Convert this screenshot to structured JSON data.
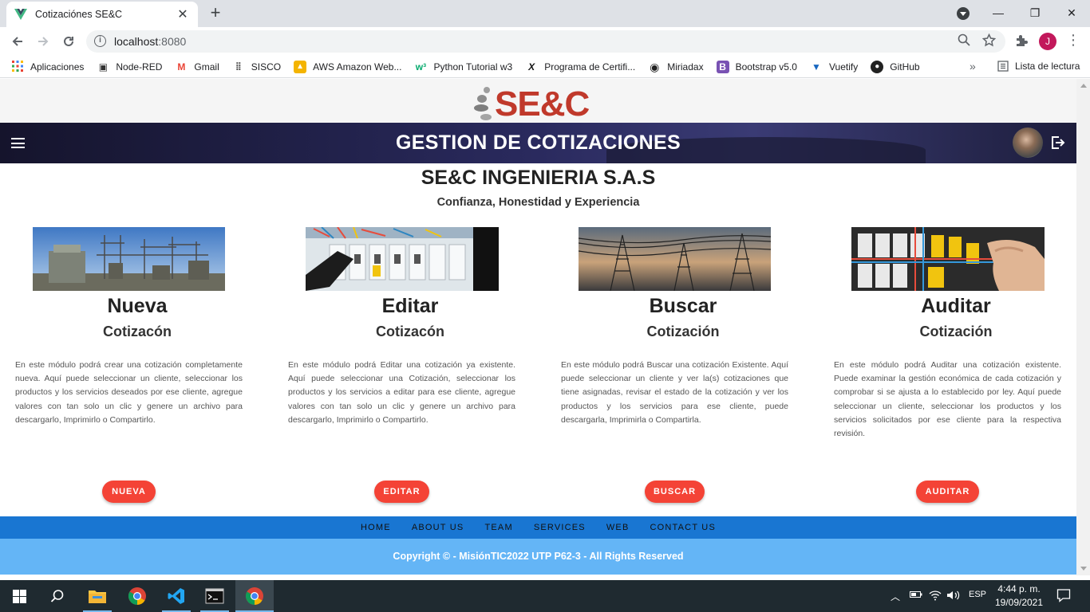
{
  "browser": {
    "tab_title": "Cotizaciónes SE&C",
    "tab_close": "✕",
    "new_tab": "+",
    "url_host": "localhost",
    "url_port": ":8080",
    "profile_initial": "J",
    "window": {
      "minimize": "—",
      "maximize": "❐",
      "close": "✕"
    }
  },
  "bookmarks": {
    "items": [
      {
        "label": "Aplicaciones",
        "icon": "apps-grid-icon"
      },
      {
        "label": "Node-RED",
        "icon": "node-red-icon"
      },
      {
        "label": "Gmail",
        "icon": "gmail-icon"
      },
      {
        "label": "SISCO",
        "icon": "sisco-icon"
      },
      {
        "label": "AWS Amazon Web...",
        "icon": "aws-icon"
      },
      {
        "label": "Python Tutorial w3",
        "icon": "w3schools-icon"
      },
      {
        "label": "Programa de Certifi...",
        "icon": "x-icon"
      },
      {
        "label": "Miriadax",
        "icon": "miriadax-icon"
      },
      {
        "label": "Bootstrap v5.0",
        "icon": "bootstrap-icon"
      },
      {
        "label": "Vuetify",
        "icon": "vuetify-icon"
      },
      {
        "label": "GitHub",
        "icon": "github-icon"
      }
    ],
    "more": "»",
    "reading_list": "Lista de lectura"
  },
  "page": {
    "logo_text": "SE&C",
    "appbar_title": "GESTION DE COTIZACIONES",
    "company": "SE&C INGENIERIA S.A.S",
    "tagline": "Confianza, Honestidad y Experiencia",
    "cards": [
      {
        "title": "Nueva",
        "subtitle": "Cotizacón",
        "description": "En este módulo podrá crear una cotización completamente nueva. Aquí puede seleccionar un cliente, seleccionar los productos y los servicios deseados por ese cliente, agregue valores con tan solo un clic y genere un archivo para descargarlo, Imprimirlo o Compartirlo.",
        "button": "NUEVA"
      },
      {
        "title": "Editar",
        "subtitle": "Cotizacón",
        "description": "En este módulo podrá Editar una cotización ya existente. Aquí puede seleccionar una Cotización, seleccionar los productos y los servicios a editar para ese cliente, agregue valores con tan solo un clic y genere un archivo para descargarlo, Imprimirlo o Compartirlo.",
        "button": "EDITAR"
      },
      {
        "title": "Buscar",
        "subtitle": "Cotización",
        "description": "En este módulo podrá Buscar una cotización Existente. Aquí puede seleccionar un cliente y ver la(s) cotizaciones que tiene asignadas, revisar el estado de la cotización y ver los productos y los servicios para ese cliente, puede descargarla, Imprimirla o Compartirla.",
        "button": "BUSCAR"
      },
      {
        "title": "Auditar",
        "subtitle": "Cotización",
        "description": "En este módulo podrá Auditar una cotización existente. Puede examinar la gestión económica de cada cotización y comprobar si se ajusta a lo establecido por ley. Aquí puede seleccionar un cliente, seleccionar los productos y los servicios solicitados por ese cliente para la respectiva revisión.",
        "button": "AUDITAR"
      }
    ],
    "footer_links": [
      "HOME",
      "ABOUT US",
      "TEAM",
      "SERVICES",
      "WEB",
      "CONTACT US"
    ],
    "copyright": "Copyright © - MisiónTIC2022 UTP P62-3 - All Rights Reserved"
  },
  "taskbar": {
    "lang": "ESP",
    "time": "4:44 p. m.",
    "date": "19/09/2021"
  },
  "colors": {
    "accent_red": "#f44336",
    "footer_blue": "#1976d2",
    "footer_light_blue": "#64b5f6",
    "appbar_dark": "#1f1f45"
  }
}
